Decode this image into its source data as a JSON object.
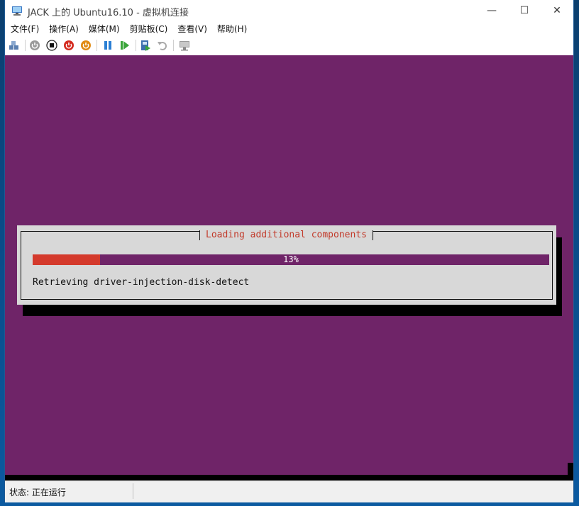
{
  "window": {
    "title": "JACK 上的 Ubuntu16.10 - 虚拟机连接",
    "controls": {
      "minimize": "—",
      "maximize": "☐",
      "close": "✕"
    }
  },
  "menu": [
    {
      "label": "文件(F)"
    },
    {
      "label": "操作(A)"
    },
    {
      "label": "媒体(M)"
    },
    {
      "label": "剪贴板(C)"
    },
    {
      "label": "查看(V)"
    },
    {
      "label": "帮助(H)"
    }
  ],
  "toolbar": {
    "icons": [
      "ctrl-alt-del-icon",
      "start-icon",
      "turn-off-icon",
      "shutdown-icon",
      "save-icon",
      "pause-icon",
      "reset-icon",
      "checkpoint-icon",
      "revert-icon",
      "enhanced-session-icon"
    ]
  },
  "installer": {
    "dialog_title": "Loading additional components",
    "progress_percent": 13,
    "progress_label": "13%",
    "message": "Retrieving driver-injection-disk-detect"
  },
  "status": {
    "text": "状态: 正在运行"
  },
  "colors": {
    "screen_bg": "#6f2468",
    "dialog_bg": "#d8d8d8",
    "progress_fill": "#d43a2c",
    "dialog_title": "#c23a2a"
  }
}
